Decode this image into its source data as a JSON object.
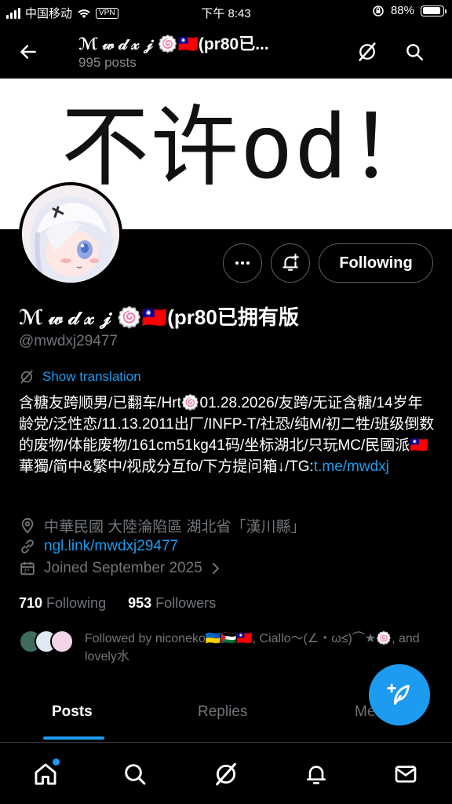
{
  "status_bar": {
    "carrier": "中国移动",
    "vpn": "VPN",
    "time": "下午 8:43",
    "battery": "88%"
  },
  "header": {
    "title": "ℳ 𝓌 𝒹 𝓍 𝒿 🍥🇹🇼(pr80已...",
    "posts_count": "995 posts"
  },
  "banner": {
    "text": "不许od！"
  },
  "actions": {
    "following_label": "Following"
  },
  "profile": {
    "display_name": "ℳ 𝓌 𝒹 𝓍 𝒿 🍥🇹🇼(pr80已拥有版",
    "handle": "@mwdxj29477",
    "show_translation": "Show translation",
    "bio_text": "含糖友跨顺男/已翻车/Hrt🍥01.28.2026/友跨/无证含糖/14岁年龄党/泛性恋/11.13.2011出厂/INFP-T/社恐/纯M/初二牲/班级倒数的废物/体能废物/161cm51kg41码/坐标湖北/只玩MC/民國派🇹🇼華獨/简中&繁中/视成分互fo/下方提问箱↓/TG:",
    "bio_link": "t.me/mwdxj",
    "location": "中華民國 大陸淪陷區 湖北省「漢川縣」",
    "website": "ngl.link/mwdxj29477",
    "joined": "Joined September 2025"
  },
  "stats": {
    "following_count": "710",
    "following_label": "Following",
    "followers_count": "953",
    "followers_label": "Followers"
  },
  "followed_by": {
    "text": "Followed by niconeko🇺🇦🇵🇸🇹🇼, Ciallo～(∠・ω≤)⌒★🍥, and lovely水"
  },
  "tabs": [
    {
      "label": "Posts"
    },
    {
      "label": "Replies"
    },
    {
      "label": "Media"
    }
  ],
  "colors": {
    "accent": "#1d9bf0",
    "background": "#000000",
    "muted": "#71767b",
    "border": "#536471"
  },
  "icons": [
    "back-arrow-icon",
    "grok-icon",
    "search-icon",
    "more-icon",
    "notification-bell-plus-icon",
    "translate-icon",
    "location-pin-icon",
    "link-icon",
    "calendar-icon",
    "compose-icon",
    "home-icon",
    "explore-icon",
    "bell-icon",
    "mail-icon"
  ]
}
